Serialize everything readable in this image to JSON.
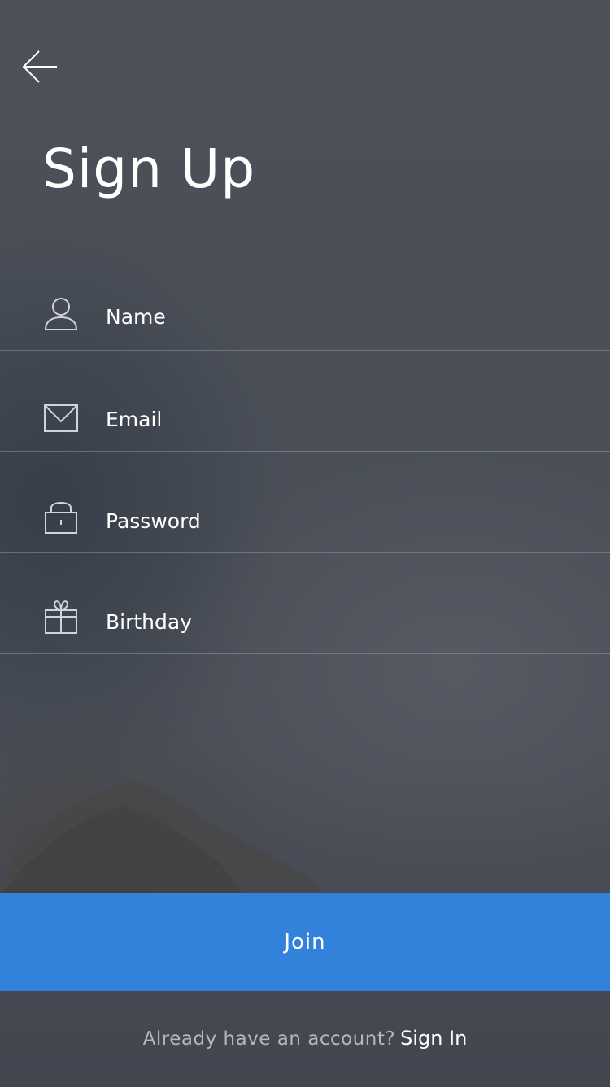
{
  "header": {
    "back_icon": "arrow-left-icon",
    "title": "Sign Up"
  },
  "form": {
    "fields": [
      {
        "icon": "user-icon",
        "placeholder": "Name",
        "value": ""
      },
      {
        "icon": "envelope-icon",
        "placeholder": "Email",
        "value": ""
      },
      {
        "icon": "lock-icon",
        "placeholder": "Password",
        "value": ""
      },
      {
        "icon": "gift-icon",
        "placeholder": "Birthday",
        "value": ""
      }
    ]
  },
  "join_button": {
    "label": "Join"
  },
  "footer": {
    "prompt": "Already have an account?",
    "sign_in_label": "Sign In"
  },
  "colors": {
    "accent": "#3282dc",
    "background": "#4b4f58",
    "divider": "#8a8f99",
    "text": "#ffffff"
  }
}
